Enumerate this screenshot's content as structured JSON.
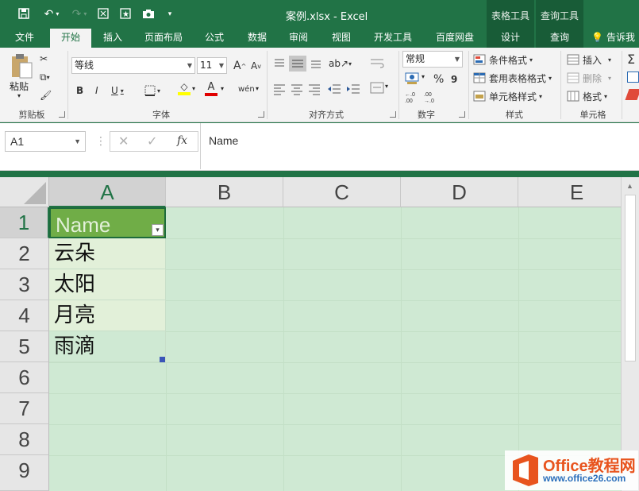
{
  "window": {
    "title": "案例.xlsx - Excel"
  },
  "context_groups": [
    {
      "label": "表格工具"
    },
    {
      "label": "查询工具"
    }
  ],
  "tabs": {
    "file": "文件",
    "home": "开始",
    "insert": "插入",
    "layout": "页面布局",
    "formulas": "公式",
    "data": "数据",
    "review": "审阅",
    "view": "视图",
    "developer": "开发工具",
    "baidu": "百度网盘",
    "design": "设计",
    "query": "查询",
    "tell_me": "告诉我"
  },
  "ribbon": {
    "clipboard": {
      "paste": "粘贴",
      "label": "剪贴板"
    },
    "font": {
      "name": "等线",
      "size": "11",
      "label": "字体",
      "bold": "B",
      "italic": "I",
      "underline": "U",
      "grow": "A",
      "shrink": "A",
      "font_color": "A",
      "phonetic": "wén"
    },
    "alignment": {
      "label": "对齐方式"
    },
    "number": {
      "format": "常规",
      "percent": "%",
      "comma": "9",
      "label": "数字"
    },
    "styles": {
      "conditional": "条件格式",
      "table": "套用表格格式",
      "cell": "单元格样式",
      "label": "样式"
    },
    "cells": {
      "insert": "插入",
      "delete": "删除",
      "format": "格式",
      "label": "单元格"
    }
  },
  "formula_bar": {
    "name_box": "A1",
    "fx": "fx",
    "value": "Name"
  },
  "grid": {
    "columns": [
      "A",
      "B",
      "C",
      "D",
      "E"
    ],
    "rows": [
      "1",
      "2",
      "3",
      "4",
      "5",
      "6",
      "7",
      "8",
      "9"
    ],
    "cells": {
      "A1": "Name",
      "A2": "云朵",
      "A3": "太阳",
      "A4": "月亮",
      "A5": "雨滴"
    }
  },
  "watermark": {
    "title": "Office教程网",
    "url": "www.office26.com"
  },
  "colors": {
    "excel_green": "#217346",
    "header_green": "#70ad47",
    "selection_tint": "#cfe9d3"
  }
}
